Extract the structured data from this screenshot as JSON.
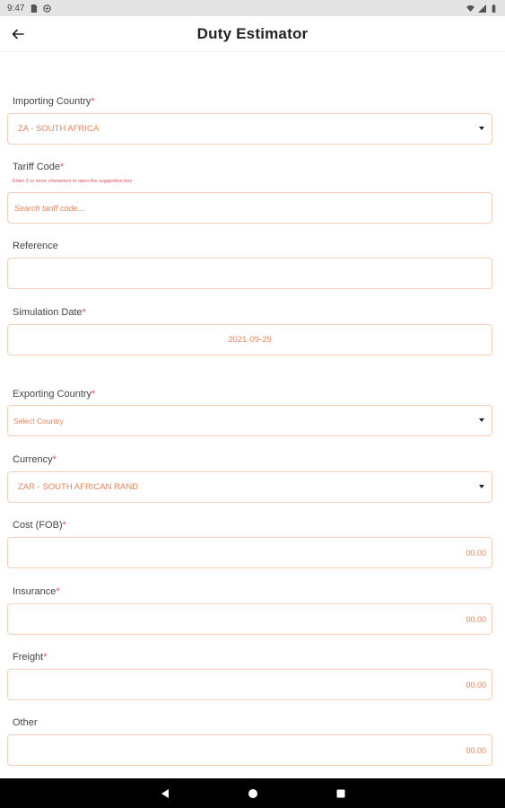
{
  "status_bar": {
    "time": "9:47",
    "icons": [
      "sd-card-icon",
      "data-saver-icon",
      "wifi-icon",
      "signal-icon",
      "battery-icon"
    ]
  },
  "app_bar": {
    "title": "Duty Estimator",
    "back_icon": "arrow-left-icon"
  },
  "form": {
    "importing_country": {
      "label": "Importing Country",
      "required": "*",
      "value": "ZA - SOUTH AFRICA"
    },
    "tariff_code": {
      "label": "Tariff Code",
      "required": "*",
      "hint": "Enter 3 or more characters to open the suggestion box",
      "placeholder": "Search tariff code..."
    },
    "reference": {
      "label": "Reference",
      "value": ""
    },
    "simulation_date": {
      "label": "Simulation Date",
      "required": "*",
      "value": "2021-09-29"
    },
    "exporting_country": {
      "label": "Exporting Country",
      "required": "*",
      "value": "Select Country"
    },
    "currency": {
      "label": "Currency",
      "required": "*",
      "value": "ZAR - SOUTH AFRICAN RAND"
    },
    "cost_fob": {
      "label": "Cost (FOB)",
      "required": "*",
      "value": "00.00"
    },
    "insurance": {
      "label": "Insurance",
      "required": "*",
      "value": "00.00"
    },
    "freight": {
      "label": "Freight",
      "required": "*",
      "value": "00.00"
    },
    "other": {
      "label": "Other",
      "value": "00.00"
    }
  },
  "nav_bar": {
    "icons": [
      "back-triangle-icon",
      "home-circle-icon",
      "recents-square-icon"
    ]
  },
  "colors": {
    "accent": "#e8845a",
    "field_border": "#f5cfb8",
    "required": "#e8505b"
  }
}
